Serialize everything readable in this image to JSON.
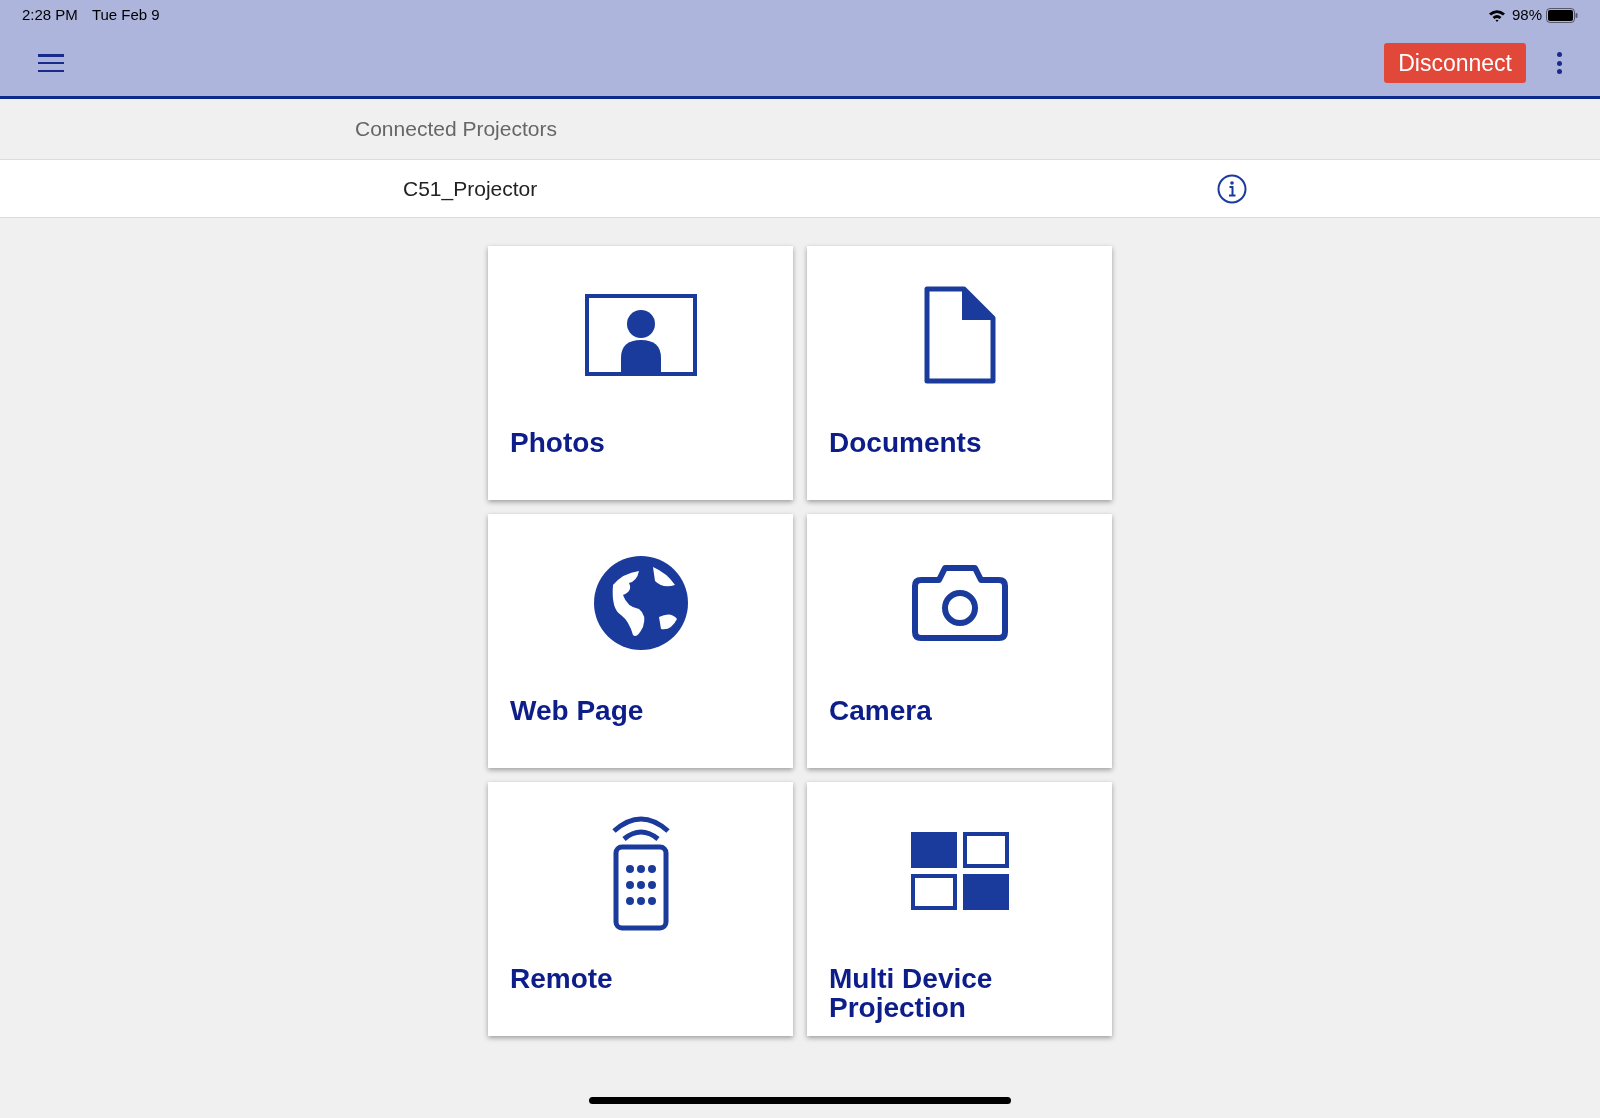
{
  "status_bar": {
    "time": "2:28 PM",
    "date": "Tue Feb 9",
    "battery": "98%"
  },
  "toolbar": {
    "disconnect": "Disconnect"
  },
  "section": {
    "title": "Connected Projectors"
  },
  "projectors": [
    {
      "name": "C51_Projector"
    }
  ],
  "tiles": [
    {
      "kind": "photos",
      "label": "Photos"
    },
    {
      "kind": "documents",
      "label": "Documents"
    },
    {
      "kind": "web",
      "label": "Web Page"
    },
    {
      "kind": "camera",
      "label": "Camera"
    },
    {
      "kind": "remote",
      "label": "Remote"
    },
    {
      "kind": "multi",
      "label": "Multi Device Projection"
    }
  ]
}
